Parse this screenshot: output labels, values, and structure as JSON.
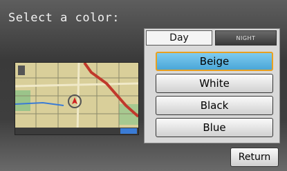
{
  "prompt": "Select a color:",
  "tabs": [
    {
      "label": "Day",
      "active": true
    },
    {
      "label": "NIGHT",
      "active": false
    }
  ],
  "options": [
    {
      "label": "Beige",
      "selected": true
    },
    {
      "label": "White",
      "selected": false
    },
    {
      "label": "Black",
      "selected": false
    },
    {
      "label": "Blue",
      "selected": false
    }
  ],
  "return_label": "Return",
  "colors": {
    "selected_fill": "#5ab4e4",
    "selected_border": "#e8a020",
    "map_background": "#d9cf9a",
    "route": "#c0392b"
  }
}
